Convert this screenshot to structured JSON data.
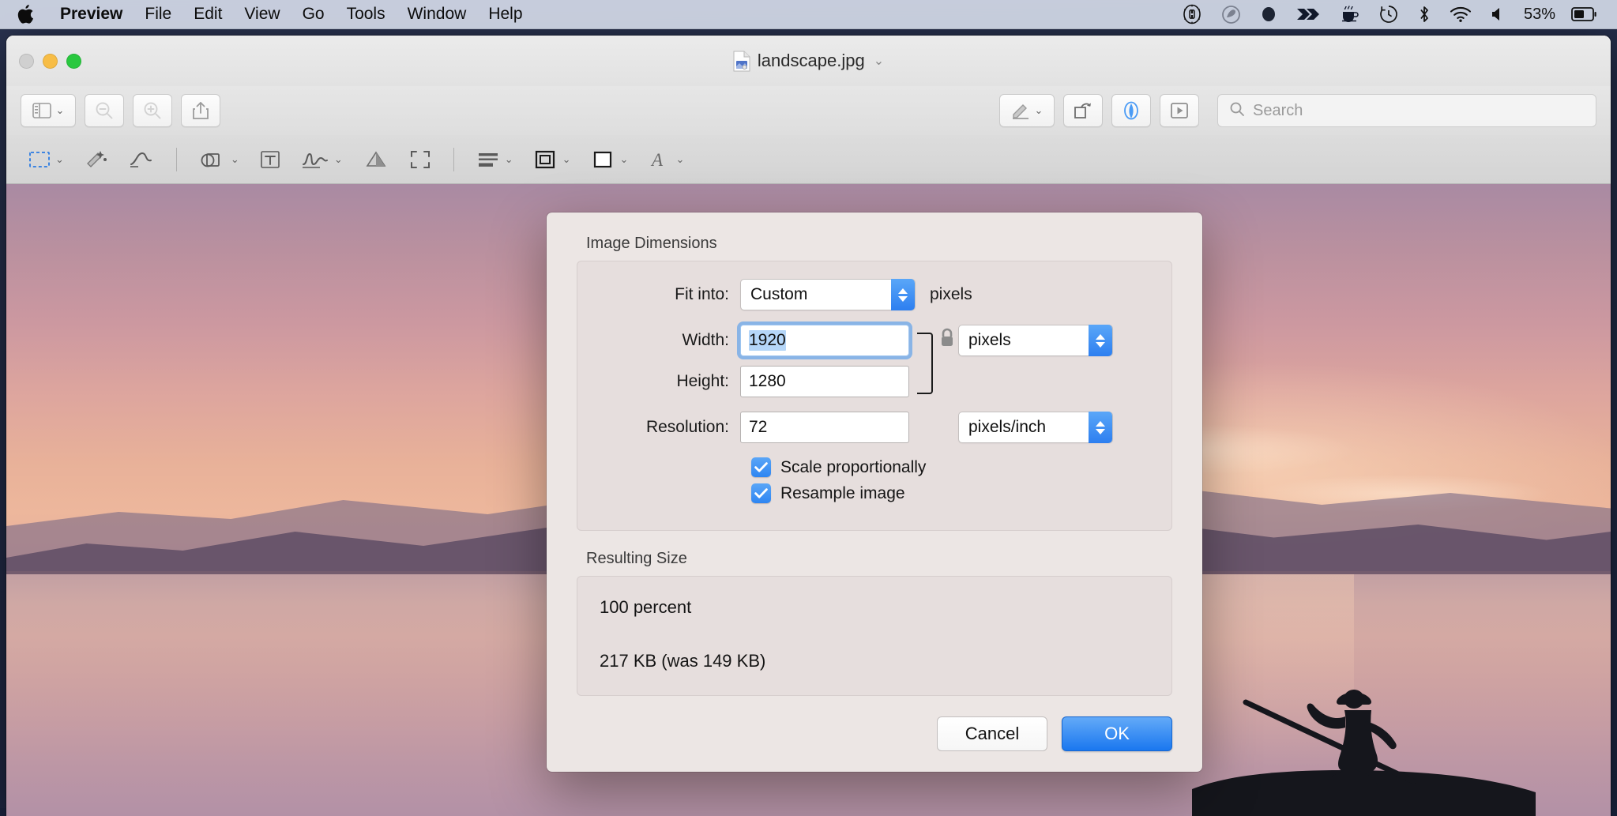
{
  "menubar": {
    "apple_icon": "apple-logo-icon",
    "items": [
      {
        "label": "Preview",
        "bold": true
      },
      {
        "label": "File",
        "bold": false
      },
      {
        "label": "Edit",
        "bold": false
      },
      {
        "label": "View",
        "bold": false
      },
      {
        "label": "Go",
        "bold": false
      },
      {
        "label": "Tools",
        "bold": false
      },
      {
        "label": "Window",
        "bold": false
      },
      {
        "label": "Help",
        "bold": false
      }
    ],
    "status_icons": [
      "command-gear-icon",
      "creative-cloud-icon",
      "dropbox-circle-icon",
      "arrows-icon",
      "coffee-cup-icon",
      "time-machine-icon",
      "bluetooth-icon",
      "wifi-icon",
      "volume-icon"
    ],
    "battery_percent": "53%",
    "battery_icon": "battery-icon"
  },
  "window": {
    "title": "landscape.jpg",
    "title_chevron": "⌄",
    "doc_icon": "jpeg-document-icon",
    "traffic_lights": [
      "close-button",
      "minimize-button",
      "zoom-button"
    ]
  },
  "toolbar": {
    "sidebar_button": "sidebar-view-icon",
    "zoom_out_button": "zoom-out-icon",
    "zoom_in_button": "zoom-in-icon",
    "share_button": "share-icon",
    "markup_toolbar_button": "markup-pen-icon",
    "rotate_button": "rotate-left-icon",
    "annotate_button": "annotate-icon",
    "slideshow_button": "slideshow-icon",
    "search_placeholder": "Search",
    "search_value": "",
    "search_icon": "search-icon"
  },
  "markup_bar": {
    "tools": [
      {
        "name": "rectangular-selection-icon",
        "has_chevron": true
      },
      {
        "name": "instant-alpha-icon",
        "has_chevron": false
      },
      {
        "name": "sketch-icon",
        "has_chevron": false
      },
      {
        "name": "shapes-icon",
        "has_chevron": true
      },
      {
        "name": "text-box-icon",
        "has_chevron": false
      },
      {
        "name": "signature-icon",
        "has_chevron": true
      },
      {
        "name": "adjust-color-icon",
        "has_chevron": false
      },
      {
        "name": "adjust-size-icon",
        "has_chevron": false
      },
      {
        "name": "shape-style-icon",
        "has_chevron": true
      },
      {
        "name": "border-color-icon",
        "has_chevron": true
      },
      {
        "name": "fill-color-icon",
        "has_chevron": true
      },
      {
        "name": "text-style-icon",
        "has_chevron": true
      }
    ]
  },
  "dialog": {
    "sections": {
      "image_dimensions_title": "Image Dimensions",
      "resulting_size_title": "Resulting Size"
    },
    "fit_into": {
      "label": "Fit into:",
      "value": "Custom",
      "units_suffix": "pixels"
    },
    "width": {
      "label": "Width:",
      "value": "1920",
      "focused": true,
      "selected": true
    },
    "height": {
      "label": "Height:",
      "value": "1280"
    },
    "size_units": {
      "value": "pixels"
    },
    "resolution": {
      "label": "Resolution:",
      "value": "72"
    },
    "resolution_units": {
      "value": "pixels/inch"
    },
    "lock_icon": "aspect-ratio-lock-icon",
    "checkboxes": [
      {
        "label": "Scale proportionally",
        "checked": true,
        "name": "scale-proportionally"
      },
      {
        "label": "Resample image",
        "checked": true,
        "name": "resample-image"
      }
    ],
    "resulting_size": {
      "percent_line": "100 percent",
      "size_line": "217 KB (was 149 KB)"
    },
    "buttons": {
      "cancel": "Cancel",
      "ok": "OK"
    }
  },
  "colors": {
    "accent_blue": "#2d7ff0",
    "ok_button_blue": "#1a77ef",
    "checkbox_blue": "#2e85f2",
    "selection_blue": "#b5d6f8",
    "menubar_bg": "#d4dae8",
    "dialog_bg": "#ece6e4"
  }
}
